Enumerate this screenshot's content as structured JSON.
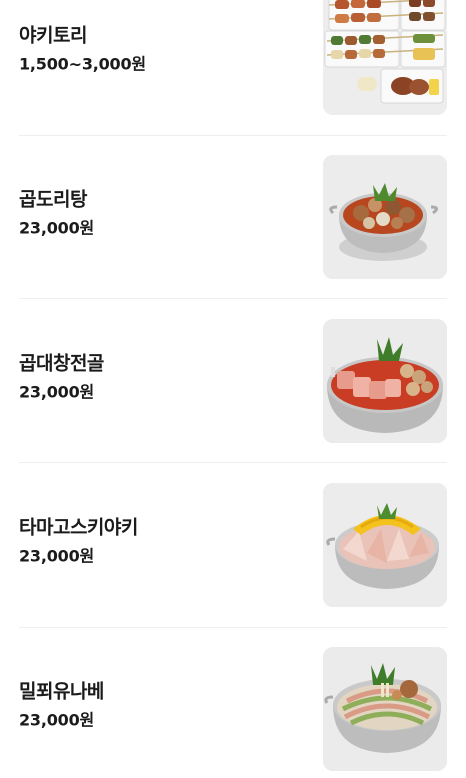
{
  "menu": {
    "items": [
      {
        "name": "야키토리",
        "price": "1,500~3,000원",
        "image": "yakitori-skewers-photo"
      },
      {
        "name": "곱도리탕",
        "price": "23,000원",
        "image": "gopdoritang-hotpot-photo"
      },
      {
        "name": "곱대창전골",
        "price": "23,000원",
        "image": "gopdaechang-jeongol-hotpot-photo"
      },
      {
        "name": "타마고스키야키",
        "price": "23,000원",
        "image": "tamago-sukiyaki-hotpot-photo"
      },
      {
        "name": "밀푀유나베",
        "price": "23,000원",
        "image": "millefeuille-nabe-hotpot-photo"
      }
    ]
  }
}
